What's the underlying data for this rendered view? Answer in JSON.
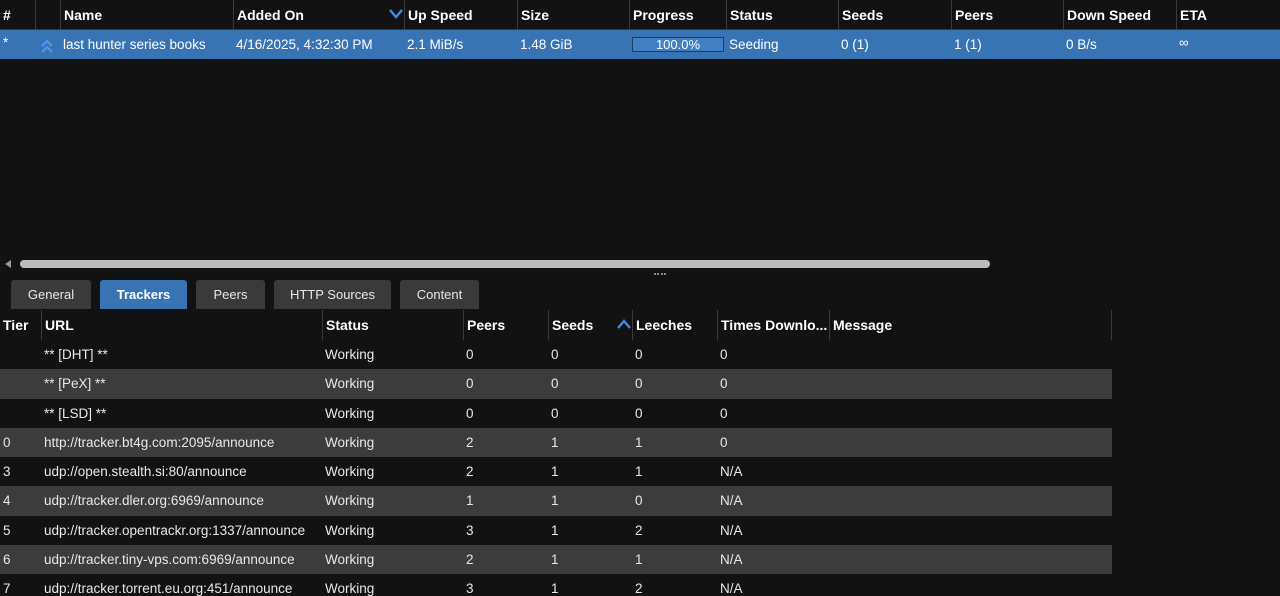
{
  "torrent_table": {
    "columns": [
      "#",
      "",
      "Name",
      "Added On",
      "Up Speed",
      "Size",
      "Progress",
      "Status",
      "Seeds",
      "Peers",
      "Down Speed",
      "ETA"
    ],
    "sorted_column": "Added On",
    "sort_direction": "descending",
    "rows": [
      {
        "queue": "*",
        "priority_icon": "double-chevron-up-icon",
        "name": "last hunter series books",
        "added_on": "4/16/2025, 4:32:30 PM",
        "up_speed": "2.1 MiB/s",
        "size": "1.48 GiB",
        "progress_text": "100.0%",
        "progress_fraction": 1.0,
        "status": "Seeding",
        "seeds": "0 (1)",
        "peers": "1 (1)",
        "down_speed": "0 B/s",
        "eta": "∞"
      }
    ]
  },
  "tabs": [
    {
      "label": "General",
      "active": false
    },
    {
      "label": "Trackers",
      "active": true
    },
    {
      "label": "Peers",
      "active": false
    },
    {
      "label": "HTTP Sources",
      "active": false
    },
    {
      "label": "Content",
      "active": false
    }
  ],
  "trackers": {
    "columns": [
      "Tier",
      "URL",
      "Status",
      "Peers",
      "Seeds",
      "Leeches",
      "Times Downlo...",
      "Message"
    ],
    "sorted_column": "Seeds",
    "sort_direction": "ascending",
    "rows": [
      {
        "tier": "",
        "url": "** [DHT] **",
        "status": "Working",
        "peers": "0",
        "seeds": "0",
        "leeches": "0",
        "times_downloaded": "0",
        "message": ""
      },
      {
        "tier": "",
        "url": "** [PeX] **",
        "status": "Working",
        "peers": "0",
        "seeds": "0",
        "leeches": "0",
        "times_downloaded": "0",
        "message": ""
      },
      {
        "tier": "",
        "url": "** [LSD] **",
        "status": "Working",
        "peers": "0",
        "seeds": "0",
        "leeches": "0",
        "times_downloaded": "0",
        "message": ""
      },
      {
        "tier": "0",
        "url": "http://tracker.bt4g.com:2095/announce",
        "status": "Working",
        "peers": "2",
        "seeds": "1",
        "leeches": "1",
        "times_downloaded": "0",
        "message": ""
      },
      {
        "tier": "3",
        "url": "udp://open.stealth.si:80/announce",
        "status": "Working",
        "peers": "2",
        "seeds": "1",
        "leeches": "1",
        "times_downloaded": "N/A",
        "message": ""
      },
      {
        "tier": "4",
        "url": "udp://tracker.dler.org:6969/announce",
        "status": "Working",
        "peers": "1",
        "seeds": "1",
        "leeches": "0",
        "times_downloaded": "N/A",
        "message": ""
      },
      {
        "tier": "5",
        "url": "udp://tracker.opentrackr.org:1337/announce",
        "status": "Working",
        "peers": "3",
        "seeds": "1",
        "leeches": "2",
        "times_downloaded": "N/A",
        "message": ""
      },
      {
        "tier": "6",
        "url": "udp://tracker.tiny-vps.com:6969/announce",
        "status": "Working",
        "peers": "2",
        "seeds": "1",
        "leeches": "1",
        "times_downloaded": "N/A",
        "message": ""
      },
      {
        "tier": "7",
        "url": "udp://tracker.torrent.eu.org:451/announce",
        "status": "Working",
        "peers": "3",
        "seeds": "1",
        "leeches": "2",
        "times_downloaded": "N/A",
        "message": ""
      }
    ]
  },
  "colors": {
    "background": "#121212",
    "selected_row": "#3874b4",
    "active_tab": "#3874b4",
    "inactive_tab": "#3a3a3a",
    "alt_row": "#3c3c3c",
    "sort_arrow": "#3b8ee8"
  }
}
